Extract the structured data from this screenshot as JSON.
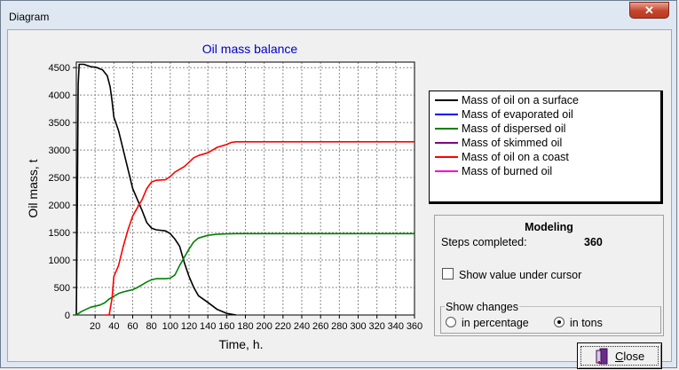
{
  "window": {
    "title": "Diagram",
    "close_glyph": "✕"
  },
  "chart_data": {
    "type": "line",
    "title": "Oil mass balance",
    "xlabel": "Time, h.",
    "ylabel": "Oil mass, t",
    "xlim": [
      0,
      360
    ],
    "ylim": [
      0,
      4600
    ],
    "xticks": [
      20,
      40,
      60,
      80,
      100,
      120,
      140,
      160,
      180,
      200,
      220,
      240,
      260,
      280,
      300,
      320,
      340,
      360
    ],
    "yticks": [
      0,
      500,
      1000,
      1500,
      2000,
      2500,
      3000,
      3500,
      4000,
      4500
    ],
    "grid": true,
    "legend_position": "right",
    "series": [
      {
        "name": "Mass of oil on a surface",
        "color": "#000000",
        "points": [
          [
            0,
            0
          ],
          [
            1,
            2000
          ],
          [
            2,
            4200
          ],
          [
            3,
            4560
          ],
          [
            8,
            4560
          ],
          [
            15,
            4520
          ],
          [
            22,
            4500
          ],
          [
            28,
            4460
          ],
          [
            33,
            4350
          ],
          [
            36,
            4150
          ],
          [
            38,
            3900
          ],
          [
            40,
            3600
          ],
          [
            45,
            3350
          ],
          [
            50,
            3000
          ],
          [
            55,
            2650
          ],
          [
            60,
            2300
          ],
          [
            65,
            2100
          ],
          [
            70,
            1900
          ],
          [
            75,
            1680
          ],
          [
            80,
            1580
          ],
          [
            85,
            1550
          ],
          [
            95,
            1530
          ],
          [
            100,
            1480
          ],
          [
            105,
            1380
          ],
          [
            110,
            1250
          ],
          [
            115,
            950
          ],
          [
            120,
            700
          ],
          [
            125,
            500
          ],
          [
            130,
            350
          ],
          [
            140,
            230
          ],
          [
            150,
            100
          ],
          [
            160,
            30
          ],
          [
            170,
            0
          ]
        ]
      },
      {
        "name": "Mass of evaporated oil",
        "color": "#0000ff",
        "points": []
      },
      {
        "name": "Mass of dispersed oil",
        "color": "#008000",
        "points": [
          [
            0,
            0
          ],
          [
            5,
            60
          ],
          [
            10,
            100
          ],
          [
            15,
            140
          ],
          [
            25,
            180
          ],
          [
            30,
            220
          ],
          [
            35,
            290
          ],
          [
            40,
            340
          ],
          [
            45,
            390
          ],
          [
            50,
            420
          ],
          [
            55,
            440
          ],
          [
            60,
            460
          ],
          [
            65,
            500
          ],
          [
            70,
            550
          ],
          [
            75,
            600
          ],
          [
            80,
            640
          ],
          [
            85,
            660
          ],
          [
            95,
            660
          ],
          [
            100,
            670
          ],
          [
            105,
            730
          ],
          [
            110,
            900
          ],
          [
            115,
            1050
          ],
          [
            120,
            1200
          ],
          [
            125,
            1330
          ],
          [
            130,
            1400
          ],
          [
            140,
            1450
          ],
          [
            150,
            1470
          ],
          [
            160,
            1475
          ],
          [
            170,
            1480
          ],
          [
            360,
            1480
          ]
        ]
      },
      {
        "name": "Mass of skimmed oil",
        "color": "#800080",
        "points": []
      },
      {
        "name": "Mass of oil on a coast",
        "color": "#ff0000",
        "points": [
          [
            30,
            0
          ],
          [
            35,
            0
          ],
          [
            38,
            300
          ],
          [
            40,
            700
          ],
          [
            45,
            900
          ],
          [
            50,
            1250
          ],
          [
            55,
            1550
          ],
          [
            60,
            1800
          ],
          [
            65,
            1950
          ],
          [
            70,
            2100
          ],
          [
            75,
            2300
          ],
          [
            80,
            2420
          ],
          [
            85,
            2450
          ],
          [
            95,
            2460
          ],
          [
            100,
            2520
          ],
          [
            105,
            2600
          ],
          [
            110,
            2650
          ],
          [
            115,
            2700
          ],
          [
            120,
            2780
          ],
          [
            125,
            2860
          ],
          [
            130,
            2900
          ],
          [
            140,
            2950
          ],
          [
            150,
            3050
          ],
          [
            160,
            3100
          ],
          [
            165,
            3140
          ],
          [
            170,
            3150
          ],
          [
            360,
            3150
          ]
        ]
      },
      {
        "name": "Mass of burned oil",
        "color": "#ff00cc",
        "points": []
      }
    ]
  },
  "panel": {
    "heading": "Modeling",
    "steps_label": "Steps completed:",
    "steps_value": "360",
    "show_value_label": "Show value under cursor",
    "show_value_checked": false,
    "group_label": "Show changes",
    "radio_percentage": "in percentage",
    "radio_tons": "in tons",
    "selected": "in tons"
  },
  "buttons": {
    "close_pre": "",
    "close_u": "C",
    "close_rest": "lose"
  },
  "icons": {
    "close_button_icon": "door-exit-icon"
  }
}
